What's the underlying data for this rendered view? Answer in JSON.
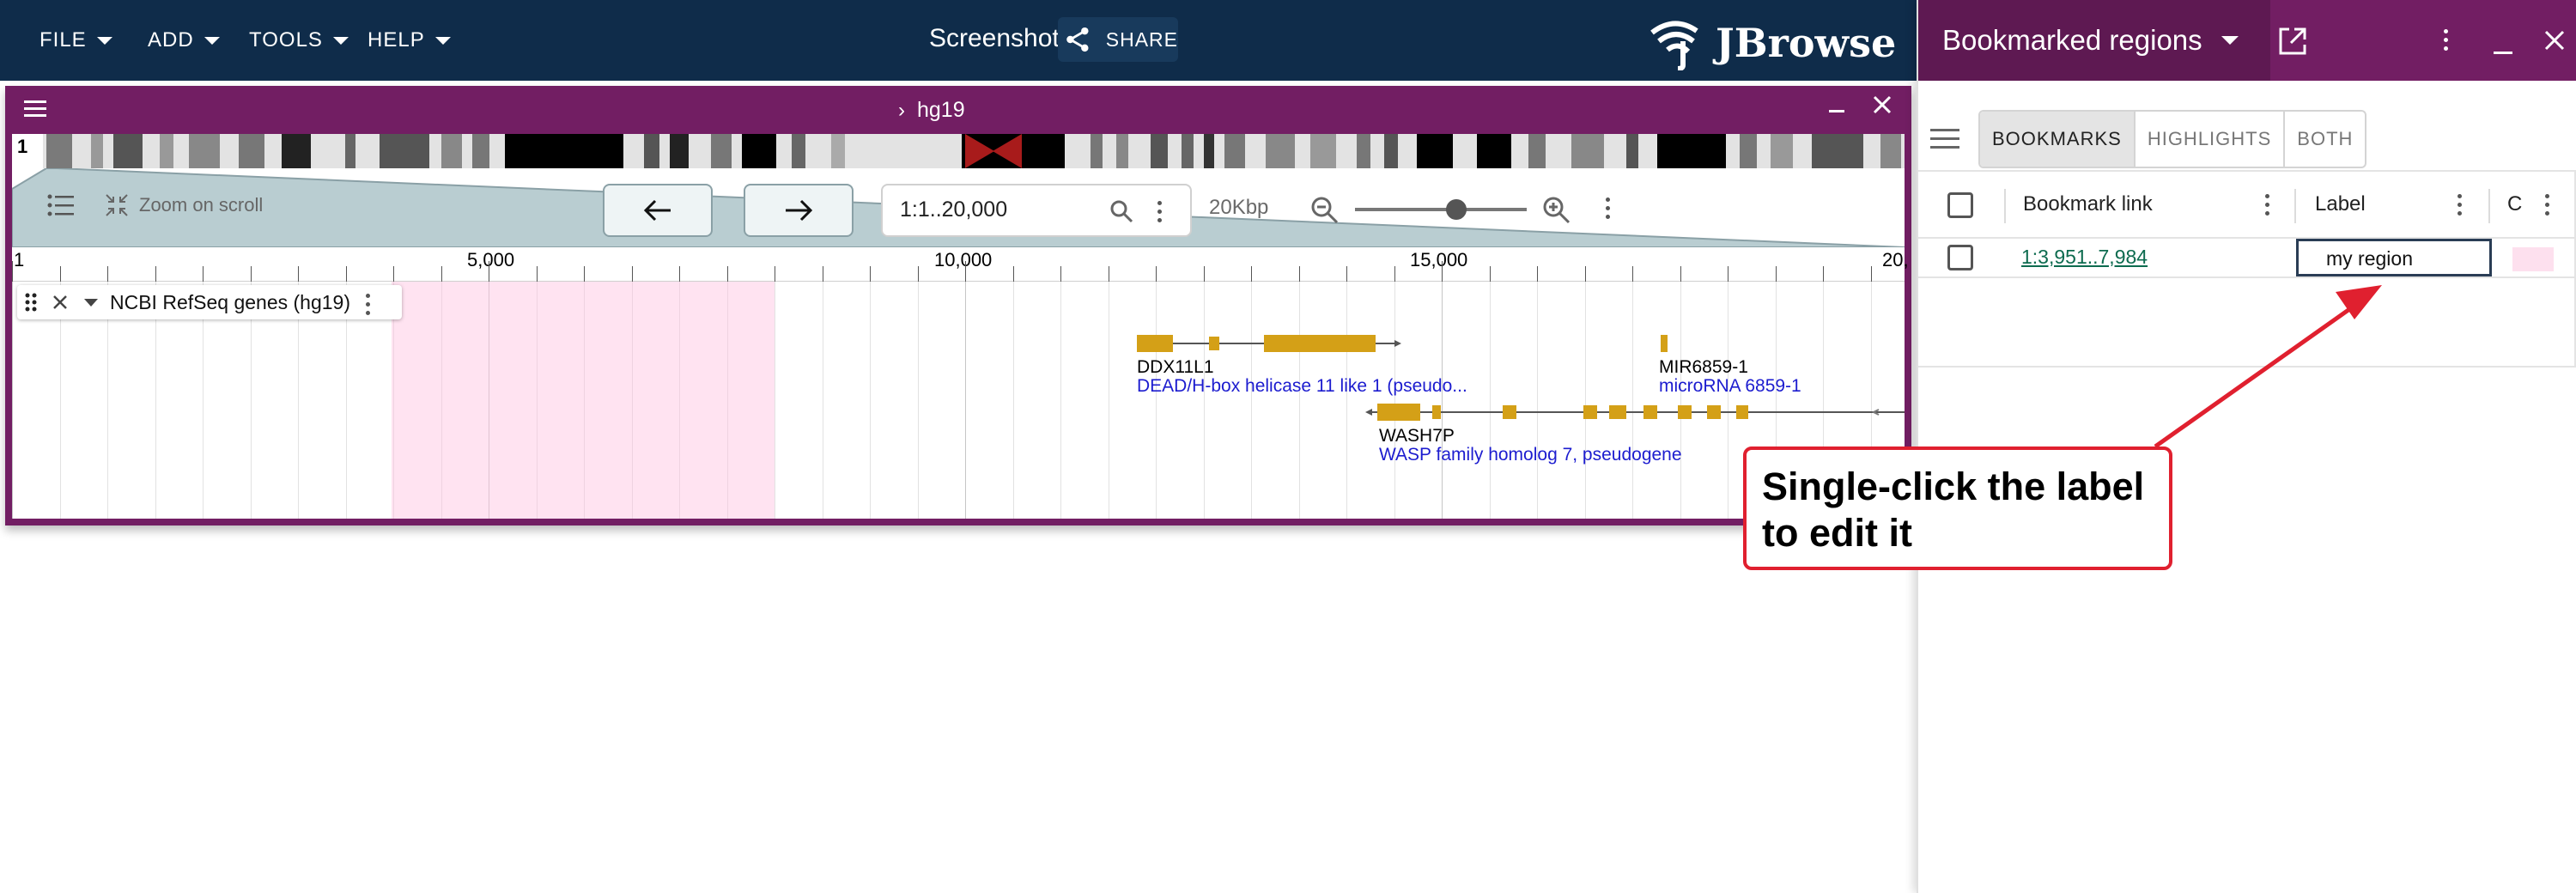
{
  "menu": {
    "file": "FILE",
    "add": "ADD",
    "tools": "TOOLS",
    "help": "HELP"
  },
  "session": {
    "name": "Screenshot",
    "share_label": "SHARE"
  },
  "brand": {
    "logo_text": "JBrowse",
    "primary_color": "#0f2c4a",
    "view_color": "#721e63"
  },
  "view": {
    "assembly": "hg19",
    "chromosome": "1",
    "zoom_on_scroll": "Zoom on scroll",
    "location": "1:1..20,000",
    "span": "20Kbp",
    "ruler": {
      "start_label": "1",
      "labels": [
        "5,000",
        "10,000",
        "15,000",
        "20,"
      ]
    },
    "track": {
      "name": "NCBI RefSeq genes (hg19)",
      "features": [
        {
          "name": "DDX11L1",
          "description": "DEAD/H-box helicase 11 like 1 (pseudo..."
        },
        {
          "name": "MIR6859-1",
          "description": "microRNA 6859-1"
        },
        {
          "name": "WASH7P",
          "description": "WASP family homolog 7, pseudogene"
        }
      ],
      "feature_color": "#d4a017"
    },
    "highlight_color": "#ffc0e0"
  },
  "drawer": {
    "title": "Bookmarked regions",
    "tabs": [
      "BOOKMARKS",
      "HIGHLIGHTS",
      "BOTH"
    ],
    "columns": {
      "link": "Bookmark link",
      "label": "Label",
      "color": "C"
    },
    "rows": [
      {
        "link": "1:3,951..7,984",
        "label": "my region"
      }
    ]
  },
  "callout": {
    "line1": "Single-click the label",
    "line2": "to edit it",
    "color": "#e0202f"
  }
}
